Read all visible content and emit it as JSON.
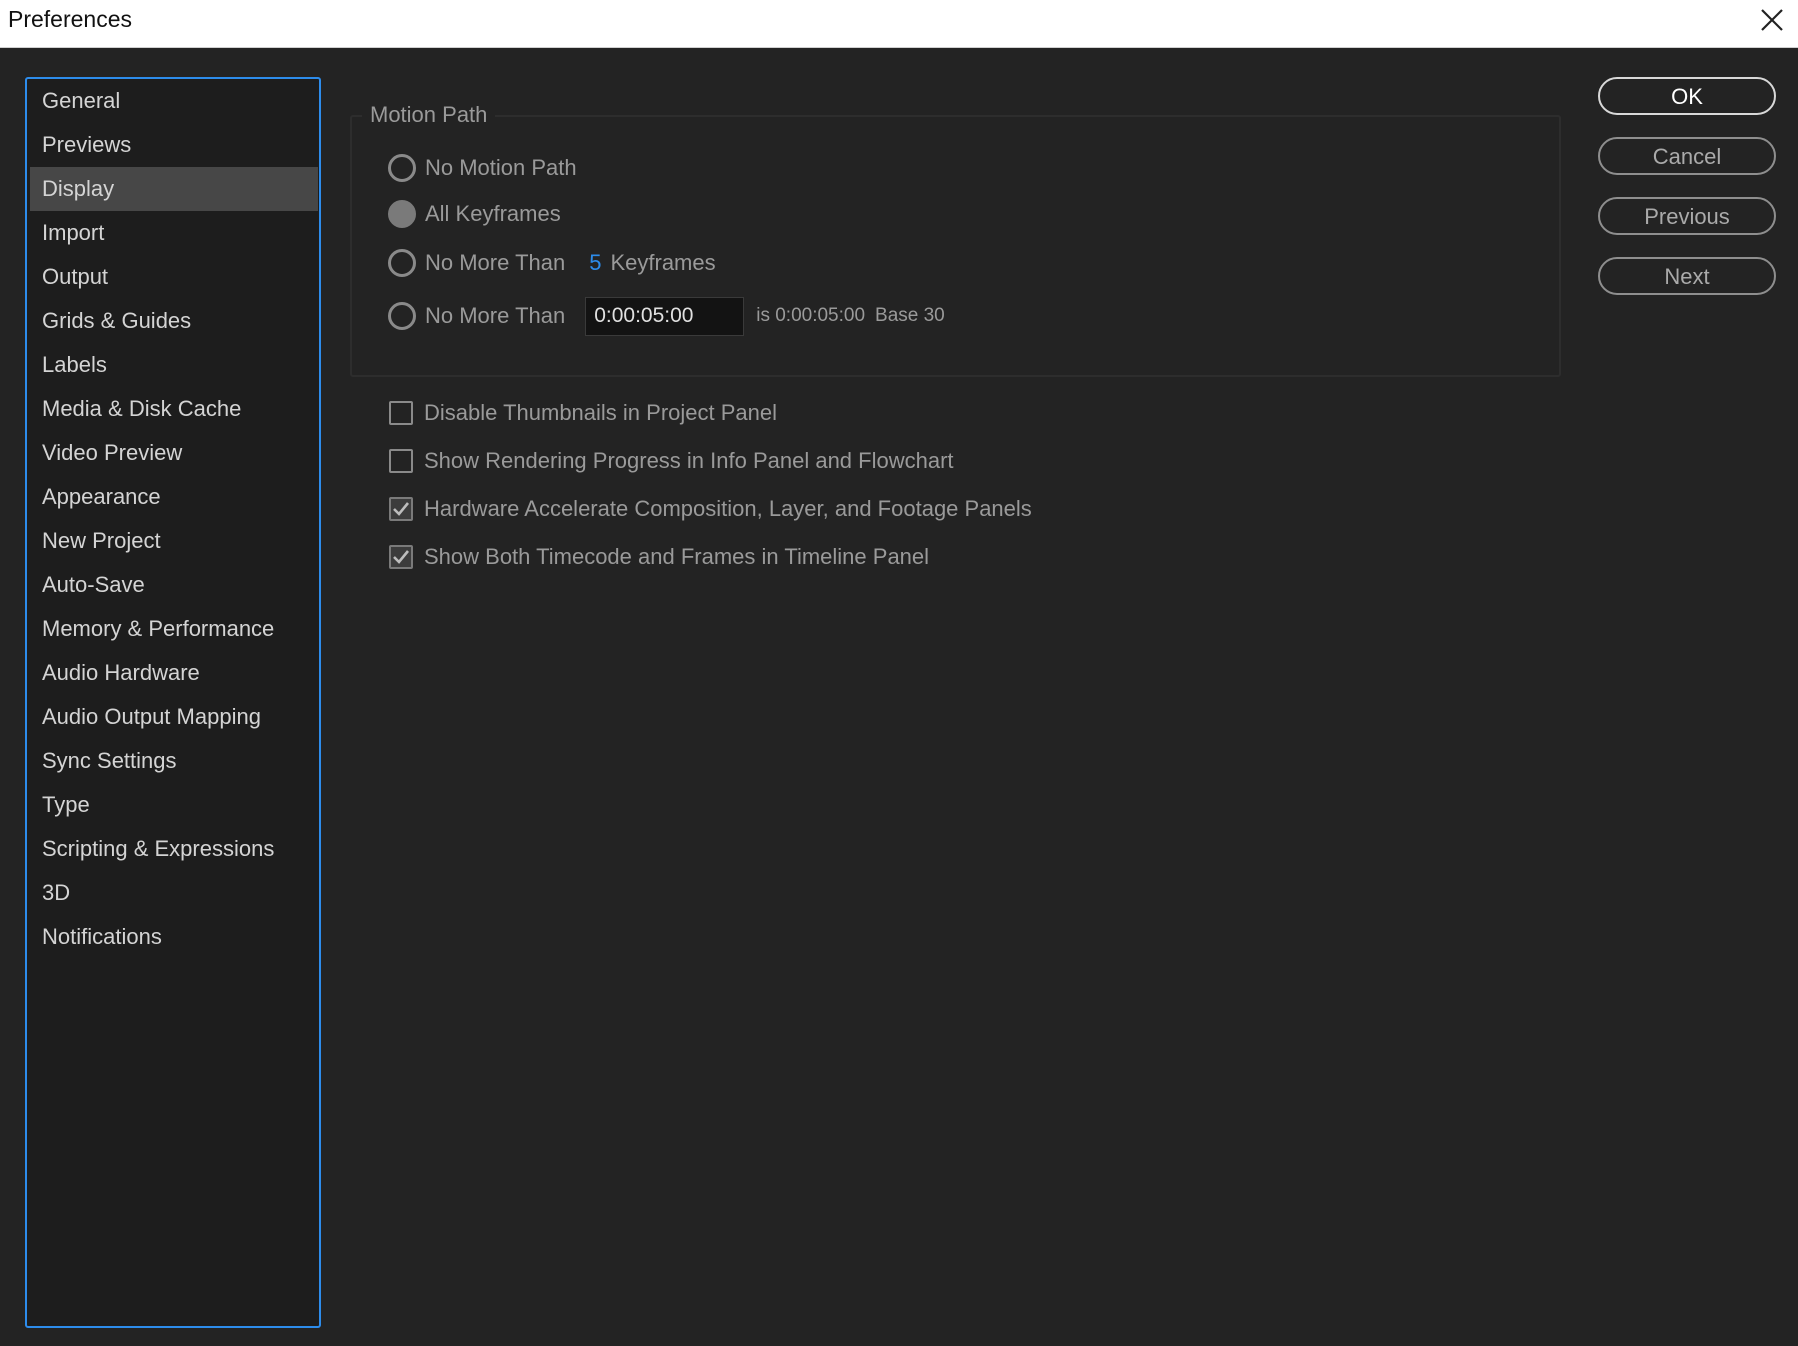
{
  "window": {
    "title": "Preferences"
  },
  "sidebar": {
    "selected": "Display",
    "items": [
      {
        "label": "General"
      },
      {
        "label": "Previews"
      },
      {
        "label": "Display"
      },
      {
        "label": "Import"
      },
      {
        "label": "Output"
      },
      {
        "label": "Grids & Guides"
      },
      {
        "label": "Labels"
      },
      {
        "label": "Media & Disk Cache"
      },
      {
        "label": "Video Preview"
      },
      {
        "label": "Appearance"
      },
      {
        "label": "New Project"
      },
      {
        "label": "Auto-Save"
      },
      {
        "label": "Memory & Performance"
      },
      {
        "label": "Audio Hardware"
      },
      {
        "label": "Audio Output Mapping"
      },
      {
        "label": "Sync Settings"
      },
      {
        "label": "Type"
      },
      {
        "label": "Scripting & Expressions"
      },
      {
        "label": "3D"
      },
      {
        "label": "Notifications"
      }
    ]
  },
  "motion_path": {
    "legend": "Motion Path",
    "selected_option": "All Keyframes",
    "options": {
      "none": "No Motion Path",
      "all": "All Keyframes",
      "max_keyframes": {
        "label": "No More Than",
        "value": "5",
        "unit": "Keyframes"
      },
      "max_time": {
        "label": "No More Than",
        "value": "0:00:05:00",
        "description": "is 0:00:05:00",
        "base": "Base 30"
      }
    }
  },
  "checkboxes": [
    {
      "label": "Disable Thumbnails in Project Panel",
      "checked": false
    },
    {
      "label": "Show Rendering Progress in Info Panel and Flowchart",
      "checked": false
    },
    {
      "label": "Hardware Accelerate Composition, Layer, and Footage Panels",
      "checked": true
    },
    {
      "label": "Show Both Timecode and Frames in Timeline Panel",
      "checked": true
    }
  ],
  "buttons": {
    "ok": "OK",
    "cancel": "Cancel",
    "previous": "Previous",
    "next": "Next"
  },
  "colors": {
    "background": "#232323",
    "accent": "#2d8ceb",
    "selected_item": "#474747"
  },
  "icons": {
    "close": "close-icon",
    "check": "checkmark-icon"
  }
}
